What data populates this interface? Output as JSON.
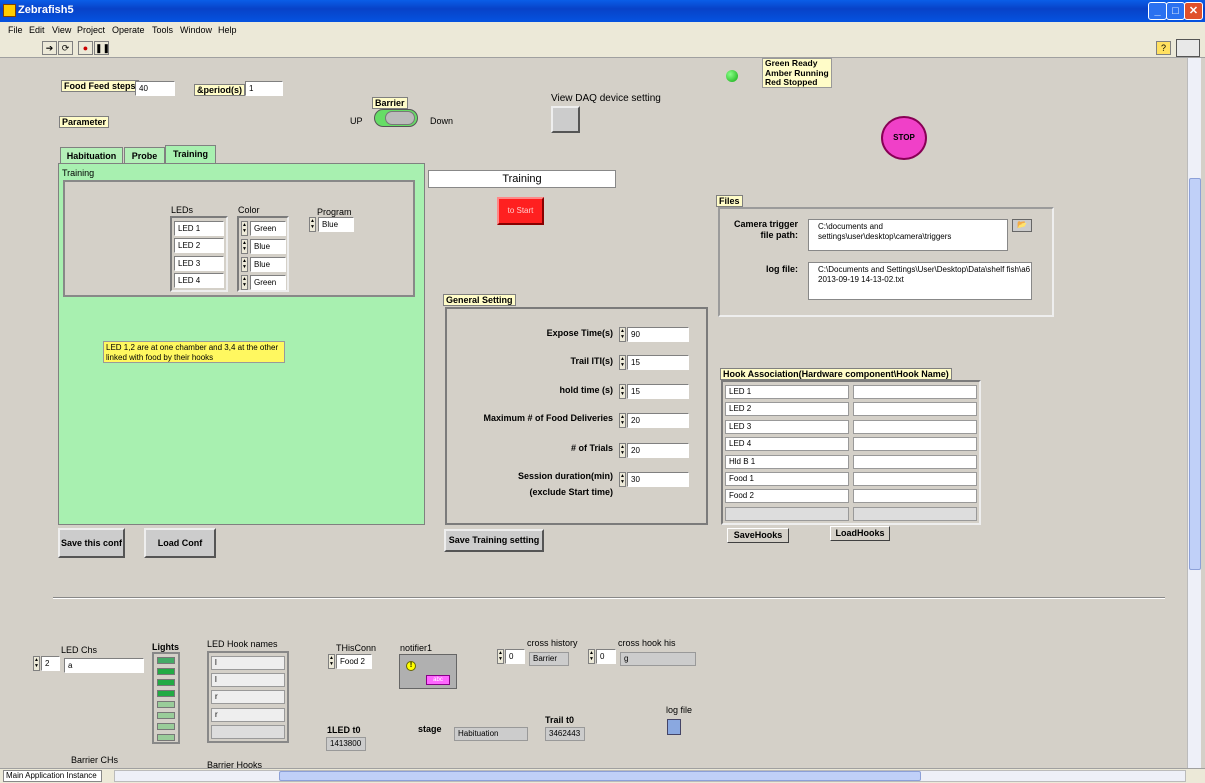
{
  "window": {
    "title": "Zebrafish5"
  },
  "menu": [
    "File",
    "Edit",
    "View",
    "Project",
    "Operate",
    "Tools",
    "Window",
    "Help"
  ],
  "food": {
    "steps_label": "Food Feed steps",
    "steps_value": "40",
    "period_label": "&period(s)",
    "period_value": "1"
  },
  "parameter_label": "Parameter",
  "barrier": {
    "label": "Barrier",
    "up": "UP",
    "down": "Down"
  },
  "daq_label": "View DAQ device setting",
  "legend": {
    "green": "Green Ready",
    "amber": "Amber Running",
    "red": "Red Stopped"
  },
  "stop_label": "STOP",
  "tabs": {
    "habituation": "Habituation",
    "probe": "Probe",
    "training": "Training"
  },
  "training": {
    "caption": "Training",
    "leds_label": "LEDs",
    "color_label": "Color",
    "program_label": "Program",
    "program_value": "Blue",
    "leds": [
      "LED 1",
      "LED 2",
      "LED 3",
      "LED 4"
    ],
    "colors": [
      "Green",
      "Blue",
      "Blue",
      "Green"
    ],
    "note": "LED 1,2 are at one chamber and 3,4 at the other linked with food by their hooks"
  },
  "mode_display": "Training",
  "to_start": "to Start",
  "files": {
    "label": "Files",
    "camera_label": "Camera trigger file path:",
    "camera_value": "C:\\documents and settings\\user\\desktop\\camera\\triggers",
    "log_label": "log file:",
    "log_value": "C:\\Documents and Settings\\User\\Desktop\\Data\\shelf fish\\a6 2013-09-19 14-13-02.txt"
  },
  "general": {
    "label": "General Setting",
    "expose_label": "Expose Time(s)",
    "expose_value": "90",
    "iti_label": "Trail ITI(s)",
    "iti_value": "15",
    "hold_label": "hold time (s)",
    "hold_value": "15",
    "maxfood_label": "Maximum # of Food Deliveries",
    "maxfood_value": "20",
    "trials_label": "# of Trials",
    "trials_value": "20",
    "session_label": "Session duration(min)",
    "session_sub": "(exclude Start time)",
    "session_value": "30"
  },
  "hooks": {
    "label": "Hook Association(Hardware component\\Hook Name)",
    "rows": [
      "LED 1",
      "LED 2",
      "LED 3",
      "LED 4",
      "Hld B 1",
      "Food 1",
      "Food 2",
      ""
    ],
    "save": "SaveHooks",
    "load": "LoadHooks"
  },
  "buttons": {
    "save_conf": "Save this conf",
    "load_conf": "Load Conf",
    "save_training": "Save Training setting"
  },
  "bottom": {
    "led_chs_label": "LED Chs",
    "led_chs_value": "2",
    "led_chs_path": "a",
    "lights_label": "Lights",
    "led_hook_label": "LED Hook names",
    "led_hooks": [
      "l",
      "l",
      "r",
      "r",
      ""
    ],
    "thisconn_label": "THisConn",
    "thisconn_value": "Food 2",
    "notifier_label": "notifier1",
    "notifier_tag": "abc",
    "cross_history_label": "cross history",
    "cross_history_idx": "0",
    "cross_history_value": "Barrier",
    "cross_hook_label": "cross hook his",
    "cross_hook_idx": "0",
    "cross_hook_value": "g",
    "led_t0_label": "1LED t0",
    "led_t0_value": "1413800",
    "stage_label": "stage",
    "stage_value": "Habituation",
    "trail_t0_label": "Trail t0",
    "trail_t0_value": "3462443",
    "logfile_label": "log file",
    "barrier_chs_label": "Barrier CHs",
    "barrier_hooks_label": "Barrier Hooks"
  },
  "status": {
    "instance": "Main Application Instance"
  },
  "colors": {
    "panel_green": "#a8f0b0",
    "stop_pink": "#f040c8",
    "start_red": "#ff2020",
    "title_blue": "#0842c8"
  }
}
